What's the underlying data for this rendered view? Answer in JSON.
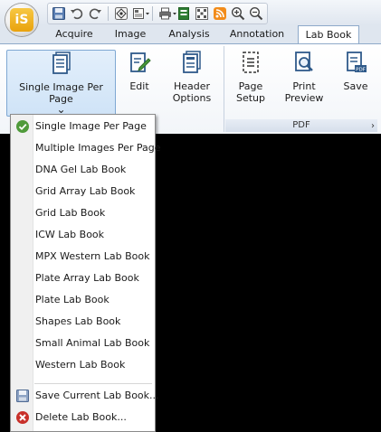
{
  "app": {
    "logo_text": "iS"
  },
  "quick_access": {
    "icons": [
      "save-icon",
      "undo-icon",
      "redo-icon",
      "capture-icon",
      "layout-icon",
      "print-icon",
      "export-icon",
      "grid-icon",
      "rss-icon",
      "zoom-in-icon",
      "zoom-out-icon"
    ]
  },
  "tabs": [
    {
      "label": "Acquire"
    },
    {
      "label": "Image"
    },
    {
      "label": "Analysis"
    },
    {
      "label": "Annotation"
    },
    {
      "label": "Lab Book",
      "active": true
    }
  ],
  "ribbon": {
    "single_image": {
      "label": "Single Image Per Page",
      "arrow": "⌄"
    },
    "edit": {
      "label": "Edit"
    },
    "header_options": {
      "label": "Header\nOptions",
      "line1": "Header",
      "line2": "Options"
    },
    "page_setup": {
      "line1": "Page",
      "line2": "Setup"
    },
    "print_preview": {
      "line1": "Print",
      "line2": "Preview"
    },
    "save": {
      "label": "Save",
      "badge": "PDF"
    },
    "pdf_group_label": "PDF",
    "launcher": "›"
  },
  "dropdown": {
    "items": [
      {
        "label": "Single Image Per Page",
        "icon": "check-icon",
        "selected": true
      },
      {
        "label": "Multiple Images Per Page"
      },
      {
        "label": "DNA Gel Lab Book"
      },
      {
        "label": "Grid Array Lab Book"
      },
      {
        "label": "Grid Lab Book"
      },
      {
        "label": "ICW Lab Book"
      },
      {
        "label": "MPX Western Lab Book"
      },
      {
        "label": "Plate Array Lab Book"
      },
      {
        "label": "Plate Lab Book"
      },
      {
        "label": "Shapes Lab Book"
      },
      {
        "label": "Small Animal Lab Book"
      },
      {
        "label": "Western Lab Book"
      }
    ],
    "actions": [
      {
        "label": "Save Current Lab Book...",
        "icon": "save-icon"
      },
      {
        "label": "Delete Lab Book...",
        "icon": "delete-icon"
      }
    ]
  },
  "colors": {
    "accent": "#4f9a3a",
    "delete": "#c8302a",
    "canvas": "#000000"
  }
}
